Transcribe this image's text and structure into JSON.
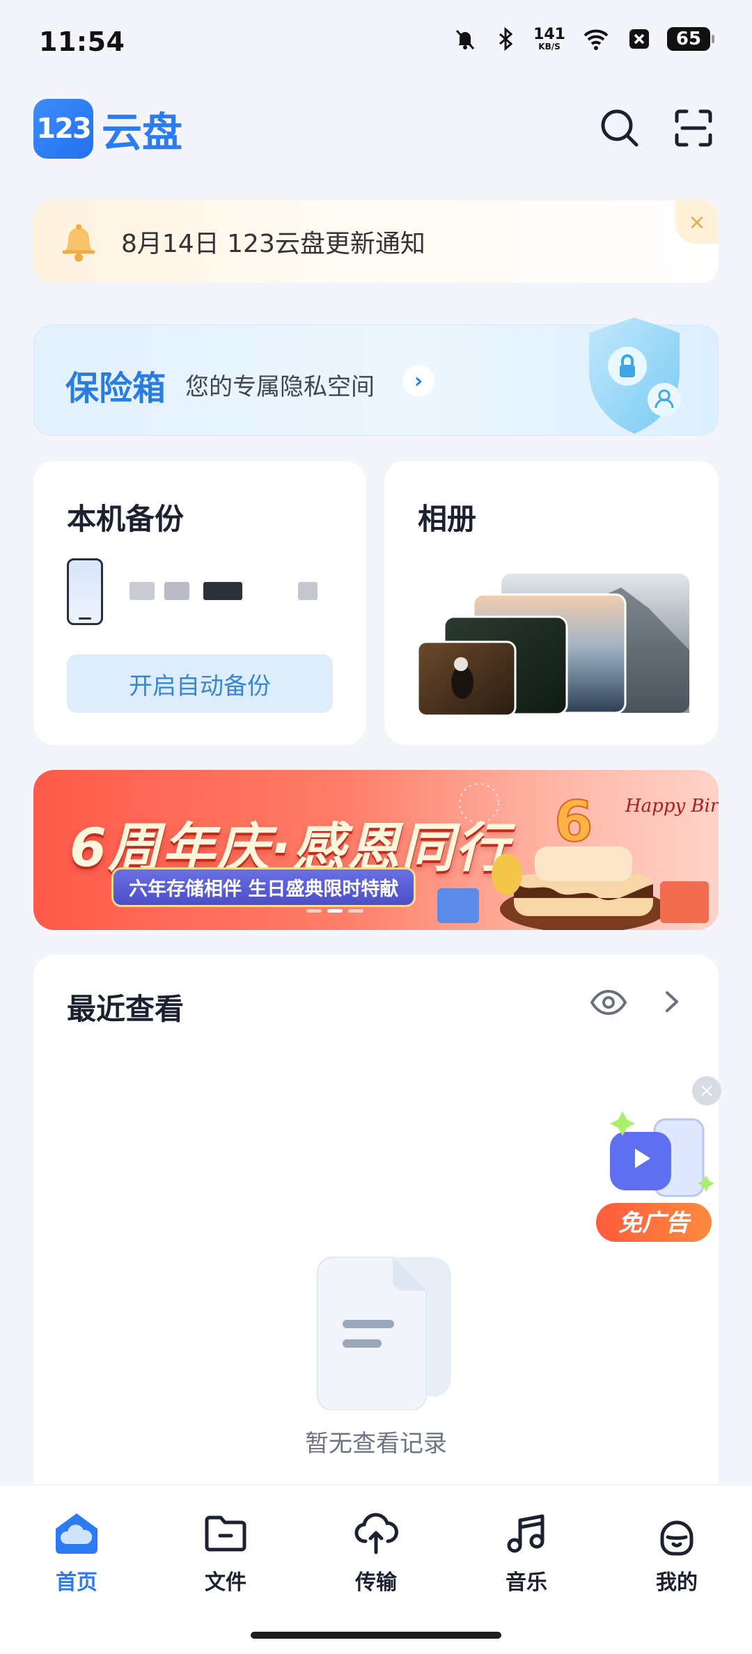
{
  "status_bar": {
    "time": "11:54",
    "net_speed_value": "141",
    "net_speed_unit": "KB/S",
    "battery": "65",
    "icons": [
      "mute-bell-icon",
      "bluetooth-icon",
      "wifi-icon",
      "x-app-icon",
      "battery-icon"
    ]
  },
  "header": {
    "logo_mark": "123",
    "logo_text": "云盘",
    "search_icon": "search-icon",
    "scan_icon": "scan-icon"
  },
  "notice": {
    "text": "8月14日 123云盘更新通知",
    "close": "×"
  },
  "safebox": {
    "title": "保险箱",
    "subtitle": "您的专属隐私空间",
    "arrow": "›"
  },
  "backup_card": {
    "title": "本机备份",
    "button": "开启自动备份"
  },
  "album_card": {
    "title": "相册"
  },
  "banner": {
    "headline": "6周年庆·感恩同行",
    "tagline": "六年存储相伴 生日盛典限时特献",
    "deco_text": "Happy Birthday",
    "active_slide": 2,
    "slide_count": 3
  },
  "recent": {
    "title": "最近查看",
    "empty_text": "暂无查看记录"
  },
  "float_ad": {
    "label": "免广告",
    "close": "×"
  },
  "bottom_nav": {
    "items": [
      {
        "label": "首页",
        "icon": "home-cloud-icon",
        "active": true
      },
      {
        "label": "文件",
        "icon": "folder-icon",
        "active": false
      },
      {
        "label": "传输",
        "icon": "transfer-cloud-icon",
        "active": false
      },
      {
        "label": "音乐",
        "icon": "music-note-icon",
        "active": false
      },
      {
        "label": "我的",
        "icon": "profile-icon",
        "active": false
      }
    ]
  },
  "colors": {
    "brand": "#2b7cf2",
    "background": "#f3f5fa",
    "banner_red": "#ff5a4a"
  }
}
